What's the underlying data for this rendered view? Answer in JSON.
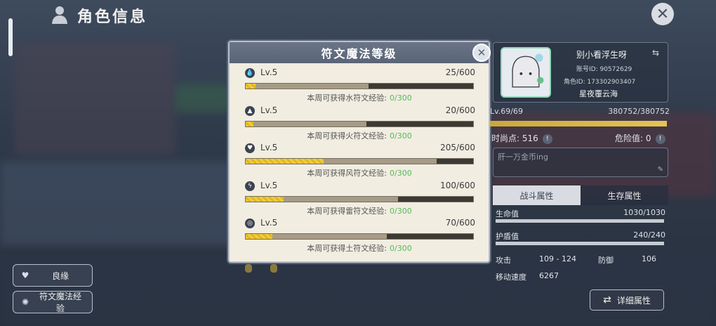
{
  "header": {
    "title": "角色信息"
  },
  "side_buttons": {
    "fate_label": "良缘",
    "rune_label": "符文魔法经验"
  },
  "modal": {
    "title": "符文魔法等级",
    "runes": [
      {
        "icon": "water-rune-icon",
        "level": "Lv.5",
        "progress": "25/600",
        "progress_ratio": 0.042,
        "mid_ratio": 0.54,
        "week_text": "本周可获得水符文经验:",
        "week_xp": "0/300"
      },
      {
        "icon": "fire-rune-icon",
        "level": "Lv.5",
        "progress": "20/600",
        "progress_ratio": 0.033,
        "mid_ratio": 0.53,
        "week_text": "本周可获得火符文经验:",
        "week_xp": "0/300"
      },
      {
        "icon": "wind-rune-icon",
        "level": "Lv.5",
        "progress": "205/600",
        "progress_ratio": 0.342,
        "mid_ratio": 0.84,
        "week_text": "本周可获得风符文经验:",
        "week_xp": "0/300"
      },
      {
        "icon": "thunder-rune-icon",
        "level": "Lv.5",
        "progress": "100/600",
        "progress_ratio": 0.167,
        "mid_ratio": 0.67,
        "week_text": "本周可获得雷符文经验:",
        "week_xp": "0/300"
      },
      {
        "icon": "earth-rune-icon",
        "level": "Lv.5",
        "progress": "70/600",
        "progress_ratio": 0.117,
        "mid_ratio": 0.62,
        "week_text": "本周可获得土符文经验:",
        "week_xp": "0/300"
      }
    ]
  },
  "profile": {
    "name": "别小看浮生呀",
    "account": "账号ID: 90572629",
    "role_id": "角色ID: 173302903407",
    "server": "星夜覆云海",
    "level": "Lv.69/69",
    "exp": "380752/380752",
    "fashion_label": "时尚点:",
    "fashion_value": "516",
    "danger_label": "危险值:",
    "danger_value": "0",
    "signature": "肝一万金币ing"
  },
  "tabs": {
    "combat": "战斗属性",
    "survival": "生存属性"
  },
  "attributes": {
    "hp_label": "生命值",
    "hp_value": "1030/1030",
    "hp_ratio": 1.0,
    "shield_label": "护盾值",
    "shield_value": "240/240",
    "shield_ratio": 1.0,
    "attack_label": "攻击",
    "attack_value": "109 - 124",
    "defense_label": "防御",
    "defense_value": "106",
    "speed_label": "移动速度",
    "speed_value": "6267"
  },
  "detail_button": {
    "label": "详细属性"
  },
  "colors": {
    "accent_xp": "#58b85b",
    "bar_fill": "#f2cc3a",
    "modal_head": "#6b7587"
  }
}
